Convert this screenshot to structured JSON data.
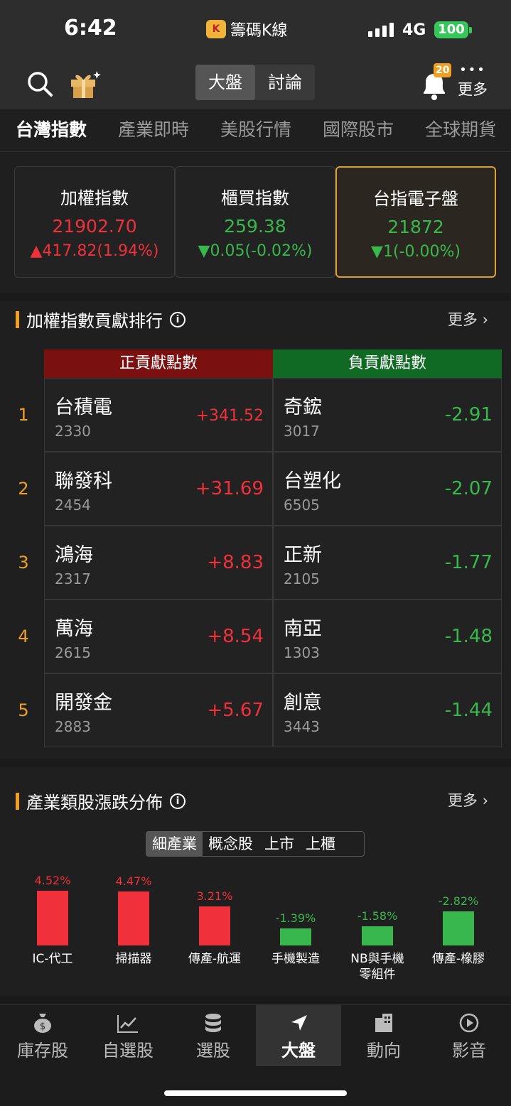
{
  "status": {
    "time": "6:42",
    "app_name": "籌碼K線",
    "network": "4G",
    "battery": "100"
  },
  "header": {
    "segments": [
      "大盤",
      "討論"
    ],
    "active_segment": "大盤",
    "notif_count": "20",
    "more_label": "更多"
  },
  "tabs": [
    "台灣指數",
    "產業即時",
    "美股行情",
    "國際股市",
    "全球期貨"
  ],
  "cards": [
    {
      "name": "加權指數",
      "value": "21902.70",
      "change": "▲417.82(1.94%)",
      "dir": "up"
    },
    {
      "name": "櫃買指數",
      "value": "259.38",
      "change": "▼0.05(-0.02%)",
      "dir": "down"
    },
    {
      "name": "台指電子盤",
      "value": "21872",
      "change": "▼1(-0.00%)",
      "dir": "down"
    }
  ],
  "ranking": {
    "title": "加權指數貢獻排行",
    "more": "更多",
    "pos_header": "正貢獻點數",
    "neg_header": "負貢獻點數",
    "rows": [
      {
        "idx": "1",
        "pos": {
          "name": "台積電",
          "code": "2330",
          "pts": "+341.52"
        },
        "neg": {
          "name": "奇鋐",
          "code": "3017",
          "pts": "-2.91"
        }
      },
      {
        "idx": "2",
        "pos": {
          "name": "聯發科",
          "code": "2454",
          "pts": "+31.69"
        },
        "neg": {
          "name": "台塑化",
          "code": "6505",
          "pts": "-2.07"
        }
      },
      {
        "idx": "3",
        "pos": {
          "name": "鴻海",
          "code": "2317",
          "pts": "+8.83"
        },
        "neg": {
          "name": "正新",
          "code": "2105",
          "pts": "-1.77"
        }
      },
      {
        "idx": "4",
        "pos": {
          "name": "萬海",
          "code": "2615",
          "pts": "+8.54"
        },
        "neg": {
          "name": "南亞",
          "code": "1303",
          "pts": "-1.48"
        }
      },
      {
        "idx": "5",
        "pos": {
          "name": "開發金",
          "code": "2883",
          "pts": "+5.67"
        },
        "neg": {
          "name": "創意",
          "code": "3443",
          "pts": "-1.44"
        }
      }
    ]
  },
  "industry": {
    "title": "產業類股漲跌分佈",
    "more": "更多",
    "segments": [
      "細產業",
      "概念股",
      "上市",
      "上櫃"
    ],
    "active_segment": "細產業",
    "bars": [
      {
        "label": "IC-代工",
        "pct": "4.52%",
        "value": 4.52
      },
      {
        "label": "掃描器",
        "pct": "4.47%",
        "value": 4.47
      },
      {
        "label": "傳產-航運",
        "pct": "3.21%",
        "value": 3.21
      },
      {
        "label": "手機製造",
        "pct": "-1.39%",
        "value": -1.39
      },
      {
        "label": "NB與手機零組件",
        "pct": "-1.58%",
        "value": -1.58
      },
      {
        "label": "傳產-橡膠",
        "pct": "-2.82%",
        "value": -2.82
      }
    ]
  },
  "bottom_nav": [
    {
      "label": "庫存股",
      "icon": "money-bag-icon"
    },
    {
      "label": "自選股",
      "icon": "chart-line-icon"
    },
    {
      "label": "選股",
      "icon": "coin-stack-icon"
    },
    {
      "label": "大盤",
      "icon": "navigation-arrow-icon"
    },
    {
      "label": "動向",
      "icon": "building-icon"
    },
    {
      "label": "影音",
      "icon": "play-circle-icon"
    }
  ],
  "colors": {
    "up": "#f0303a",
    "down": "#38b84c",
    "accent": "#f0a020",
    "pos_header": "#7a1010",
    "neg_header": "#106a24"
  }
}
